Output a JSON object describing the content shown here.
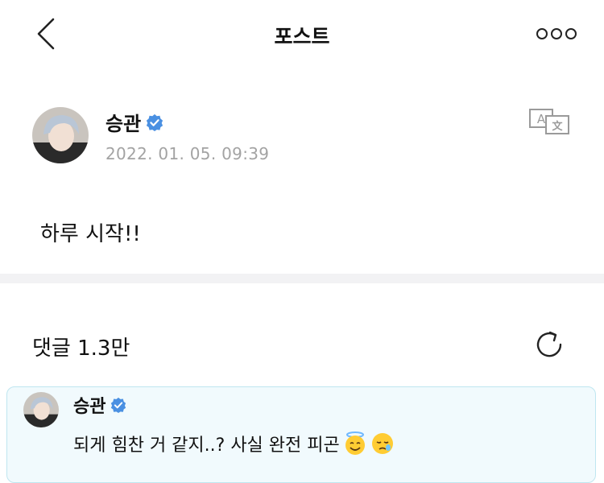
{
  "header": {
    "title": "포스트",
    "back_icon": "chevron-left-icon",
    "more_icon": "more-dots-icon"
  },
  "post": {
    "author": "승관",
    "verified_icon": "verified-badge-icon",
    "date": "2022. 01. 05. 09:39",
    "translate_icon": "translate-icon",
    "text": "하루 시작!!"
  },
  "comments": {
    "count_label": "댓글 1.3만",
    "refresh_icon": "refresh-icon",
    "highlighted": {
      "author": "승관",
      "text": "되게 힘찬 거 같지..? 사실 완전 피곤",
      "emojis": [
        "halo-smile-emoji",
        "sleepy-face-emoji"
      ]
    }
  },
  "colors": {
    "verified": "#4a90e2",
    "date": "#a3a3a3",
    "card_bg": "#f1fafd",
    "card_border": "#bfe6f0",
    "divider": "#f2f2f4"
  }
}
